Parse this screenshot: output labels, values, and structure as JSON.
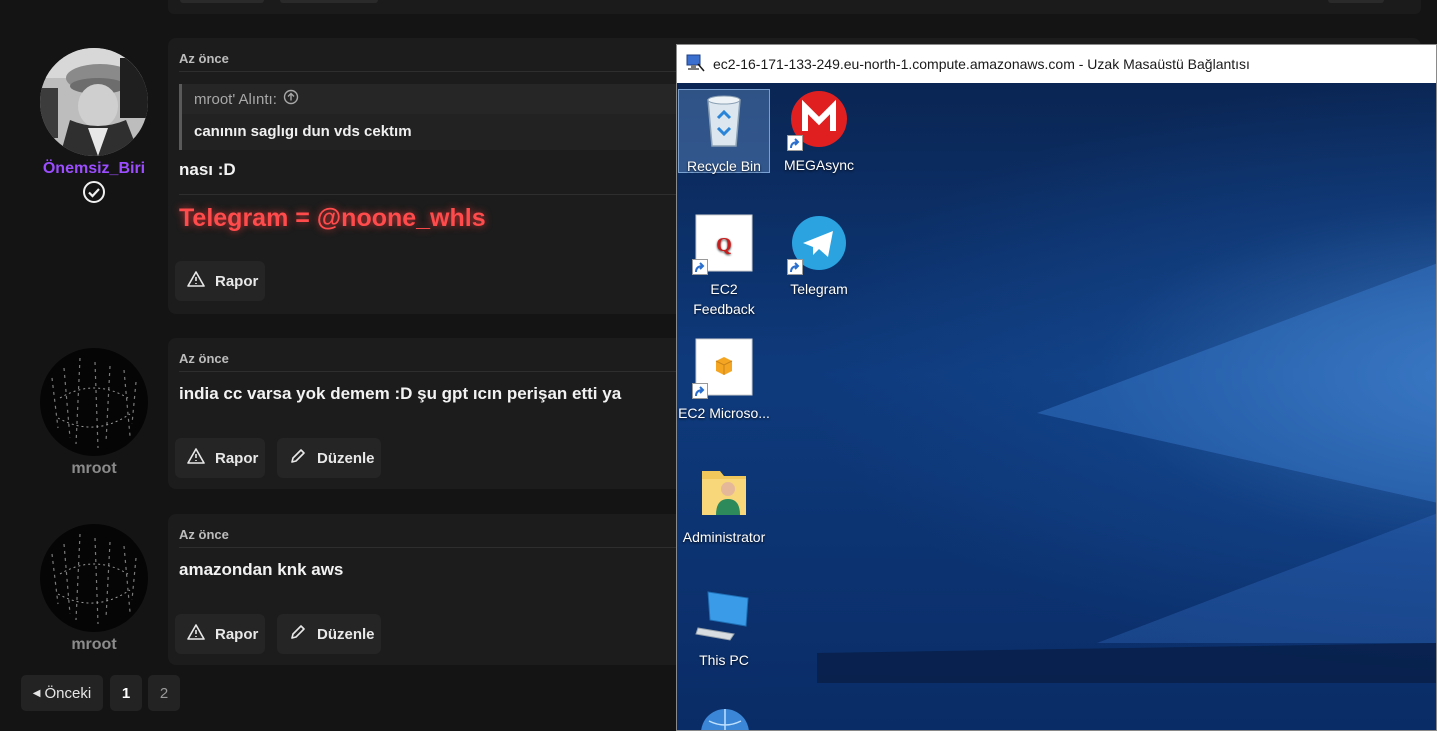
{
  "forum": {
    "posts": [
      {
        "time": "Az önce",
        "username": "Önemsiz_Biri",
        "quote_author": "mroot' Alıntı:",
        "quote_text": "canının saglıgı dun vds cektım",
        "message": "nası :D",
        "signature": "Telegram = @noone_whls",
        "buttons": [
          "Rapor"
        ]
      },
      {
        "time": "Az önce",
        "username": "mroot",
        "message": "india cc varsa yok demem :D şu gpt ıcın perişan etti ya",
        "buttons": [
          "Rapor",
          "Düzenle"
        ]
      },
      {
        "time": "Az önce",
        "username": "mroot",
        "message": "amazondan knk aws",
        "buttons": [
          "Rapor",
          "Düzenle"
        ]
      }
    ],
    "pagination": {
      "prev": "Önceki",
      "pages": [
        "1",
        "2"
      ],
      "current": "1"
    }
  },
  "rdp": {
    "title": "ec2-16-171-133-249.eu-north-1.compute.amazonaws.com - Uzak Masaüstü Bağlantısı",
    "icons": [
      {
        "label": "Recycle Bin",
        "icon": "recycle-bin-icon"
      },
      {
        "label": "MEGAsync",
        "icon": "megasync-icon"
      },
      {
        "label": "EC2 Feedback",
        "icon": "ec2-feedback-icon"
      },
      {
        "label": "Telegram",
        "icon": "telegram-icon"
      },
      {
        "label": "EC2 Microso...",
        "icon": "ec2-microsoft-icon"
      },
      {
        "label": "Administrator",
        "icon": "user-folder-icon"
      },
      {
        "label": "This PC",
        "icon": "this-pc-icon"
      }
    ]
  },
  "colors": {
    "accent_purple": "#9b4dff",
    "telegram_red": "#ff4b4b",
    "desktop_blue": "#0e3a7c"
  }
}
